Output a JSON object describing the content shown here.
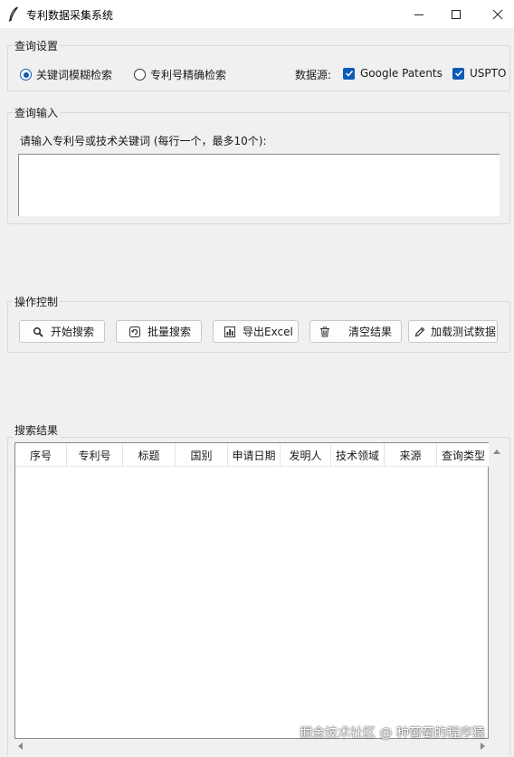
{
  "window": {
    "title": "专利数据采集系统",
    "feather_icon": "feather-icon",
    "minimize_icon": "minimize-icon",
    "maximize_icon": "maximize-icon",
    "close_icon": "close-icon"
  },
  "query_settings": {
    "group_label": "查询设置",
    "mode_options": [
      {
        "label": "关键词模糊检索",
        "selected": true
      },
      {
        "label": "专利号精确检索",
        "selected": false
      }
    ],
    "source_label": "数据源:",
    "sources": [
      {
        "label": "Google Patents",
        "checked": true
      },
      {
        "label": "USPTO",
        "checked": true
      }
    ]
  },
  "query_input": {
    "group_label": "查询输入",
    "prompt": "请输入专利号或技术关键词 (每行一个，最多10个):",
    "value": ""
  },
  "actions": {
    "group_label": "操作控制",
    "buttons": [
      {
        "label": "开始搜索",
        "icon": "search-icon"
      },
      {
        "label": "批量搜索",
        "icon": "refresh-icon"
      },
      {
        "label": "导出Excel",
        "icon": "chart-icon"
      },
      {
        "label": "清空结果",
        "icon": "trash-icon"
      },
      {
        "label": "加载测试数据",
        "icon": "pencil-icon"
      }
    ]
  },
  "results": {
    "group_label": "搜索结果",
    "columns": [
      "序号",
      "专利号",
      "标题",
      "国别",
      "申请日期",
      "发明人",
      "技术领域",
      "来源",
      "查询类型"
    ],
    "rows": []
  },
  "watermark": "掘金技术社区 @ 种葡萄的程序猿",
  "colors": {
    "accent": "#0a5bb5",
    "background": "#f0f0f0"
  }
}
